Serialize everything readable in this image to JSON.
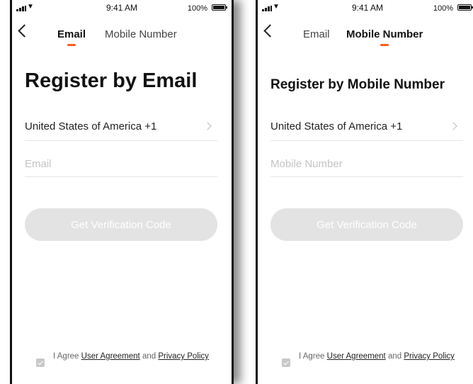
{
  "status_bar": {
    "time": "9:41 AM",
    "battery": "100%"
  },
  "screens": [
    {
      "tabs": [
        {
          "label": "Email",
          "active": true
        },
        {
          "label": "Mobile Number",
          "active": false
        }
      ],
      "title": "Register by Email",
      "country": "United States of America +1",
      "field_placeholder": "Email",
      "button": "Get Verification Code",
      "agreement": {
        "prefix": "I Agree",
        "user_agreement": "User Agreement",
        "and": "and",
        "privacy_policy": "Privacy Policy",
        "checked": true
      }
    },
    {
      "tabs": [
        {
          "label": "Email",
          "active": false
        },
        {
          "label": "Mobile Number",
          "active": true
        }
      ],
      "title": "Register by Mobile Number",
      "country": "United States of America +1",
      "field_placeholder": "Mobile Number",
      "button": "Get Verification Code",
      "agreement": {
        "prefix": "I Agree",
        "user_agreement": "User Agreement",
        "and": "and",
        "privacy_policy": "Privacy Policy",
        "checked": true
      }
    }
  ],
  "colors": {
    "accent": "#ff5a1f",
    "button_disabled": "#e3e3e3",
    "placeholder": "#c4c4c4"
  },
  "icons": {
    "back": "chevron-left-icon",
    "country_chevron": "chevron-right-icon",
    "checkbox": "checkbox-checked-icon"
  }
}
